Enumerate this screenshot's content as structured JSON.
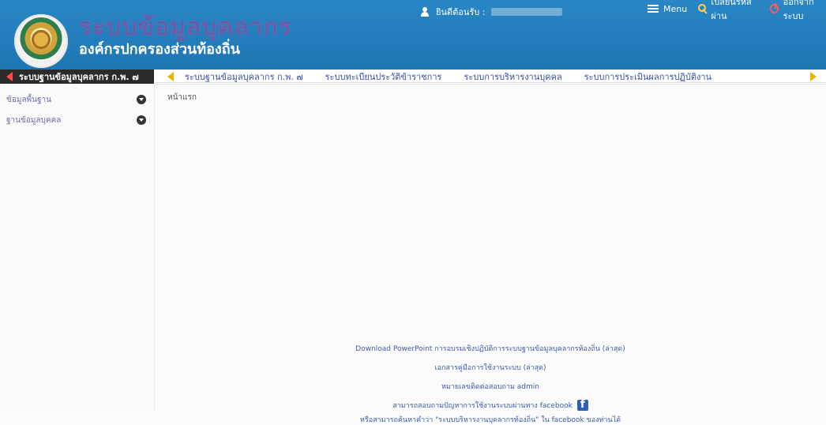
{
  "header": {
    "title": "ระบบข้อมูลบุคลากร",
    "subtitle": "องค์กรปกครองส่วนท้องถิ่น",
    "welcome_label": "ยินดีต้อนรับ :",
    "menu_label": "Menu",
    "change_password_label": "เปลี่ยนรหัสผ่าน",
    "logout_label": "ออกจากระบบ"
  },
  "menu": {
    "left_title": "ระบบฐานข้อมูลบุคลากร ก.พ. ๗",
    "tabs": [
      {
        "label": "ระบบฐานข้อมูลบุคลากร ก.พ. ๗"
      },
      {
        "label": "ระบบทะเบียนประวัติข้าราชการ"
      },
      {
        "label": "ระบบการบริหารงานบุคคล"
      },
      {
        "label": "ระบบการประเมินผลการปฏิบัติงาน"
      }
    ]
  },
  "sidebar": {
    "items": [
      {
        "label": "ข้อมูลพื้นฐาน"
      },
      {
        "label": "ฐานข้อมูลบุคคล"
      }
    ]
  },
  "content": {
    "page_title": "หน้าแรก"
  },
  "footer": {
    "download_ppt": "Download PowerPoint การอบรมเชิงปฏิบัติการระบบฐานข้อมูลบุคลากรท้องถิ่น (ล่าสุด)",
    "manual": "เอกสารคู่มือการใช้งานระบบ (ล่าสุด)",
    "admin_contact": "หมายเลขติดต่อสอบถาม admin",
    "fb_line": "สามารถสอบถามปัญหาการใช้งานระบบผ่านทาง facebook",
    "fb_note": "หรือสามารถค้นหาคำว่า \"ระบบบริหารงานบุคลากรท้องถิ่น\" ใน facebook ของท่านได้"
  }
}
